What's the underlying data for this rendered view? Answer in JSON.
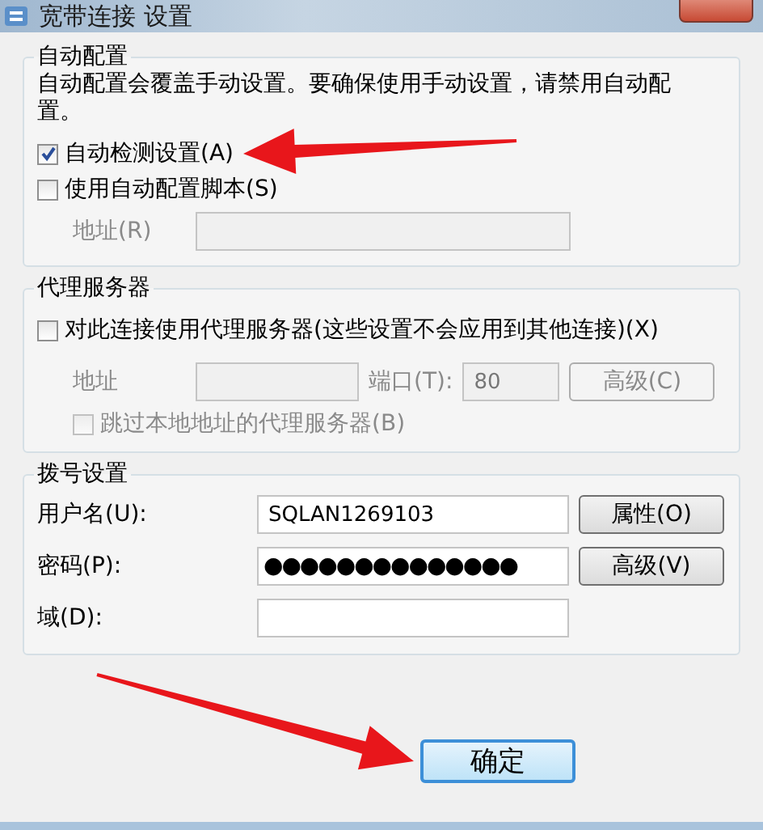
{
  "window": {
    "title": "宽带连接 设置"
  },
  "auto_config": {
    "heading": "自动配置",
    "description": "自动配置会覆盖手动设置。要确保使用手动设置，请禁用自动配置。",
    "options": [
      {
        "label": "自动检测设置(A)",
        "checked": true
      },
      {
        "label": "使用自动配置脚本(S)",
        "checked": false
      }
    ],
    "address": {
      "label": "地址(R)",
      "disabled": true
    }
  },
  "proxy": {
    "heading": "代理服务器",
    "use_proxy": {
      "label": "对此连接使用代理服务器(这些设置不会应用到其他连接)(X)",
      "checked": false
    },
    "disabled": true,
    "address_label": "地址",
    "port_label": "端口(T):",
    "port": "80",
    "advanced_button": "高级(C)",
    "bypass": {
      "label": "跳过本地地址的代理服务器(B)",
      "checked": false
    }
  },
  "dialup": {
    "heading": "拨号设置",
    "fields": [
      {
        "label": "用户名(U):",
        "value": "SQLAN1269103",
        "button": "属性(O)"
      },
      {
        "label": "密码(P):",
        "value": "●●●●●●●●●●●●●●",
        "button": "高级(V)"
      },
      {
        "label": "域(D):"
      }
    ]
  },
  "buttons": [
    {
      "label": "确定",
      "default": true
    }
  ],
  "annotations": [
    {
      "kind": "arrow"
    },
    {
      "kind": "arrow"
    }
  ]
}
